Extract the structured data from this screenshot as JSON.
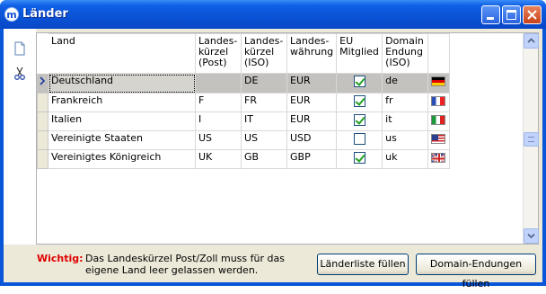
{
  "window": {
    "title": "Länder",
    "app_icon_letter": "m"
  },
  "table": {
    "headers": {
      "land": "Land",
      "kuerzel_post": [
        "Landes-",
        "kürzel",
        "(Post)"
      ],
      "kuerzel_iso": [
        "Landes-",
        "kürzel",
        "(ISO)"
      ],
      "waehrung": [
        "Landes-",
        "währung"
      ],
      "eu": [
        "EU",
        "Mitglied"
      ],
      "domain": [
        "Domain",
        "Endung",
        "(ISO)"
      ]
    },
    "rows": [
      {
        "land": "Deutschland",
        "post": "",
        "iso": "DE",
        "waehrung": "EUR",
        "eu": true,
        "domain": "de",
        "flag": "flag-de"
      },
      {
        "land": "Frankreich",
        "post": "F",
        "iso": "FR",
        "waehrung": "EUR",
        "eu": true,
        "domain": "fr",
        "flag": "flag-fr"
      },
      {
        "land": "Italien",
        "post": "I",
        "iso": "IT",
        "waehrung": "EUR",
        "eu": true,
        "domain": "it",
        "flag": "flag-it"
      },
      {
        "land": "Vereinigte Staaten",
        "post": "US",
        "iso": "US",
        "waehrung": "USD",
        "eu": false,
        "domain": "us",
        "flag": "flag-us"
      },
      {
        "land": "Vereinigtes Königreich",
        "post": "UK",
        "iso": "GB",
        "waehrung": "GBP",
        "eu": true,
        "domain": "uk",
        "flag": "flag-gb"
      }
    ]
  },
  "footer": {
    "label": "Wichtig:",
    "text": "Das Landeskürzel Post/Zoll muss für das eigene Land leer gelassen werden.",
    "btn_laenderliste": "Länderliste füllen",
    "btn_domain": "Domain-Endungen füllen"
  },
  "icons": {
    "new": "new-document-icon",
    "cut": "scissors-icon",
    "selected_row": "row-pointer-icon"
  }
}
